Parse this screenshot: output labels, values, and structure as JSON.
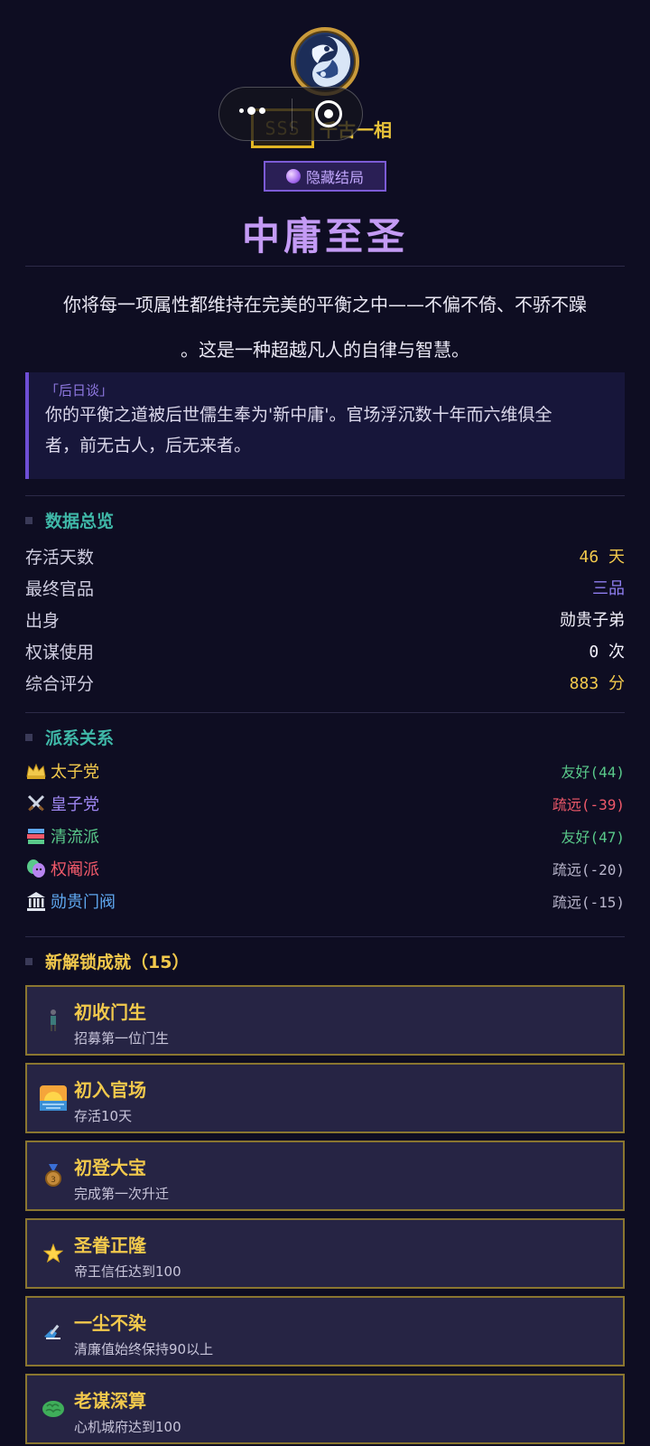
{
  "header": {
    "grade": "SSS",
    "grade_subtitle": "千古一相",
    "ending_tag": "隐藏结局",
    "ending_title": "中庸至圣",
    "description_line1": "你将每一项属性都维持在完美的平衡之中——不偏不倚、不骄不躁",
    "description_line2": "。这是一种超越凡人的自律与智慧。"
  },
  "epilogue": {
    "label": "「后日谈」",
    "line1": "你的平衡之道被后世儒生奉为'新中庸'。官场浮沉数十年而六维俱全",
    "line2": "者，前无古人，后无来者。"
  },
  "overview": {
    "title": "数据总览",
    "rows": [
      {
        "label": "存活天数",
        "value": "46 天",
        "color": "#f2c94c"
      },
      {
        "label": "最终官品",
        "value": "三品",
        "color": "#8f7ef0"
      },
      {
        "label": "出身",
        "value": "勋贵子弟",
        "color": "#f2f0fa"
      },
      {
        "label": "权谋使用",
        "value": "0 次",
        "color": "#f2f0fa"
      },
      {
        "label": "综合评分",
        "value": "883 分",
        "color": "#f2c94c"
      }
    ]
  },
  "factions": {
    "title": "派系关系",
    "rows": [
      {
        "icon": "crown-icon",
        "name": "太子党",
        "name_color": "#f2c94c",
        "relation": "友好(44)",
        "relation_color": "#59c98a"
      },
      {
        "icon": "crossed-swords-icon",
        "name": "皇子党",
        "name_color": "#9d86f0",
        "relation": "疏远(-39)",
        "relation_color": "#f0596a"
      },
      {
        "icon": "books-icon",
        "name": "清流派",
        "name_color": "#59c98a",
        "relation": "友好(47)",
        "relation_color": "#59c98a"
      },
      {
        "icon": "theater-masks-icon",
        "name": "权阉派",
        "name_color": "#f0596a",
        "relation": "疏远(-20)",
        "relation_color": "#b9b6cc"
      },
      {
        "icon": "classical-building-icon",
        "name": "勋贵门阀",
        "name_color": "#5fa8f0",
        "relation": "疏远(-15)",
        "relation_color": "#b9b6cc"
      }
    ]
  },
  "achievements": {
    "title": "新解锁成就（15）",
    "items": [
      {
        "icon": "student-icon",
        "title": "初收门生",
        "desc": "招募第一位门生"
      },
      {
        "icon": "sunrise-icon",
        "title": "初入官场",
        "desc": "存活10天"
      },
      {
        "icon": "medal-icon",
        "title": "初登大宝",
        "desc": "完成第一次升迁"
      },
      {
        "icon": "star-icon",
        "title": "圣眷正隆",
        "desc": "帝王信任达到100"
      },
      {
        "icon": "broom-icon",
        "title": "一尘不染",
        "desc": "清廉值始终保持90以上"
      },
      {
        "icon": "brain-icon",
        "title": "老谋深算",
        "desc": "心机城府达到100"
      }
    ]
  },
  "colors": {
    "background": "#0e0d22",
    "accent_purple": "#c49bf5",
    "accent_gold": "#f2c94c",
    "section_teal": "#3fb8a8"
  }
}
